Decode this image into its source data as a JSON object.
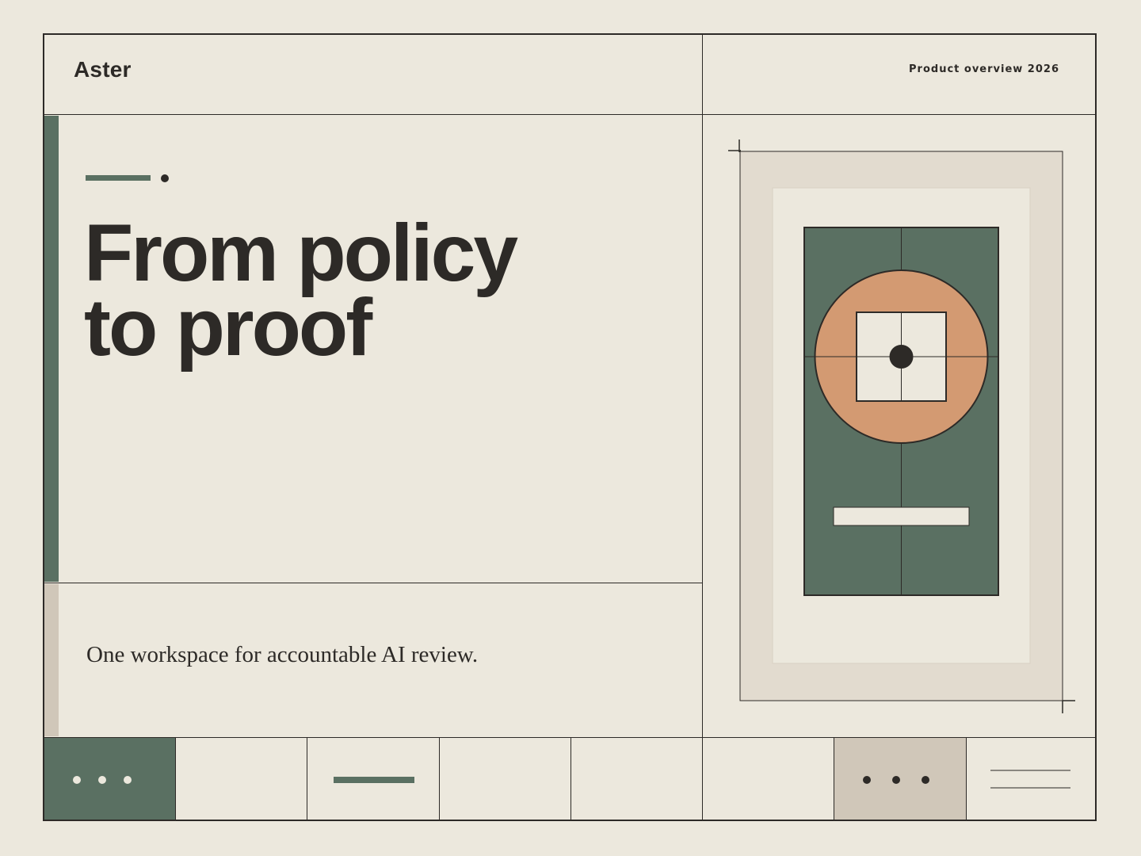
{
  "header": {
    "brand": "Aster",
    "subtitle": "Product overview 2026"
  },
  "hero": {
    "headline_line1": "From policy",
    "headline_line2": "to proof",
    "tagline": "One workspace for accountable AI review."
  },
  "palette": {
    "background": "#ece8dd",
    "ink": "#2d2a27",
    "green": "#5a7062",
    "tan": "#d0c7b9",
    "orange": "#d39a72",
    "sand": "#e2dbcf"
  },
  "footer_cells": [
    {
      "kind": "dots-light-on-green"
    },
    {
      "kind": "empty"
    },
    {
      "kind": "green-dash"
    },
    {
      "kind": "empty"
    },
    {
      "kind": "empty"
    },
    {
      "kind": "empty"
    },
    {
      "kind": "dots-dark-on-tan"
    },
    {
      "kind": "double-rule"
    }
  ],
  "icons": [
    "accent-dash",
    "accent-dot",
    "target-artwork",
    "ellipsis-icon",
    "hamburger-lines-icon"
  ]
}
